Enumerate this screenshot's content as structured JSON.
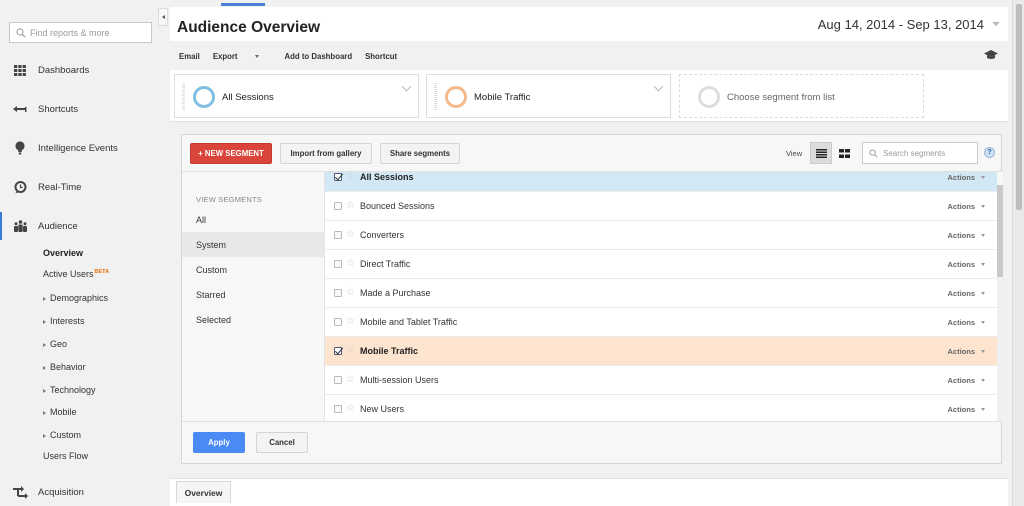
{
  "sidebar": {
    "search_placeholder": "Find reports & more",
    "nav": [
      {
        "label": "Dashboards",
        "icon": "grid-icon"
      },
      {
        "label": "Shortcuts",
        "icon": "shortcut-arrow-icon"
      },
      {
        "label": "Intelligence Events",
        "icon": "lightbulb-icon"
      },
      {
        "label": "Real-Time",
        "icon": "clock-icon"
      },
      {
        "label": "Audience",
        "icon": "people-icon",
        "active": true
      },
      {
        "label": "Acquisition",
        "icon": "acquisition-arrows-icon"
      }
    ],
    "audience_sub": [
      {
        "label": "Overview",
        "bold": true
      },
      {
        "label": "Active Users",
        "badge": "BETA"
      },
      {
        "label": "Demographics",
        "expandable": true
      },
      {
        "label": "Interests",
        "expandable": true
      },
      {
        "label": "Geo",
        "expandable": true
      },
      {
        "label": "Behavior",
        "expandable": true
      },
      {
        "label": "Technology",
        "expandable": true
      },
      {
        "label": "Mobile",
        "expandable": true
      },
      {
        "label": "Custom",
        "expandable": true
      },
      {
        "label": "Users Flow"
      }
    ]
  },
  "header": {
    "title": "Audience Overview",
    "date_range": "Aug 14, 2014 - Sep 13, 2014",
    "toolbar": {
      "email": "Email",
      "export": "Export",
      "add_to_dashboard": "Add to Dashboard",
      "shortcut": "Shortcut"
    }
  },
  "segment_bar": {
    "cards": [
      {
        "label": "All Sessions",
        "color": "#7fbfe0"
      },
      {
        "label": "Mobile Traffic",
        "color": "#f3b98a"
      },
      {
        "label": "Choose segment from list",
        "color": "#dddddd",
        "empty": true
      }
    ]
  },
  "segment_panel": {
    "new_segment": "+ NEW SEGMENT",
    "import_gallery": "Import from gallery",
    "share_segments": "Share segments",
    "view_label": "View",
    "search_placeholder": "Search segments",
    "help": "?",
    "categories_heading": "VIEW SEGMENTS",
    "categories": [
      {
        "label": "All"
      },
      {
        "label": "System",
        "selected": true
      },
      {
        "label": "Custom"
      },
      {
        "label": "Starred"
      },
      {
        "label": "Selected"
      }
    ],
    "actions_label": "Actions",
    "rows": [
      {
        "name": "All Sessions",
        "checked": true,
        "highlight": "blue"
      },
      {
        "name": "Bounced Sessions",
        "checked": false
      },
      {
        "name": "Converters",
        "checked": false
      },
      {
        "name": "Direct Traffic",
        "checked": false
      },
      {
        "name": "Made a Purchase",
        "checked": false
      },
      {
        "name": "Mobile and Tablet Traffic",
        "checked": false
      },
      {
        "name": "Mobile Traffic",
        "checked": true,
        "highlight": "orange"
      },
      {
        "name": "Multi-session Users",
        "checked": false
      },
      {
        "name": "New Users",
        "checked": false
      }
    ],
    "apply": "Apply",
    "cancel": "Cancel"
  },
  "bottom_tabs": {
    "overview": "Overview"
  },
  "colors": {
    "new_segment_red": "#d9453a",
    "apply_blue": "#4a8af4",
    "selected_blue_row": "#d2e8f4",
    "selected_orange_row": "#fde4cf",
    "beta_orange": "#e8710a"
  }
}
